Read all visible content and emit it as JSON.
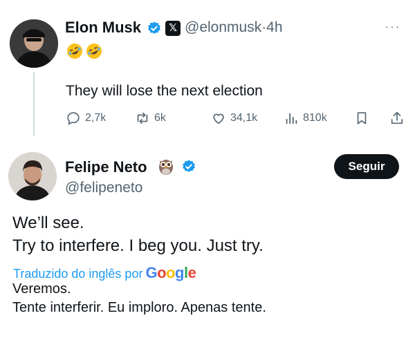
{
  "tweet1": {
    "author_name": "Elon Musk",
    "handle_time": "@elonmusk·4h",
    "more_icon": "more-horizontal-icon",
    "emojis": [
      "rofl-emoji",
      "rofl-emoji"
    ],
    "text": "They will lose the next election",
    "actions": {
      "reply_count": "2,7k",
      "retweet_count": "6k",
      "like_count": "34,1k",
      "view_count": "810k"
    }
  },
  "tweet2": {
    "author_name": "Felipe Neto",
    "handle": "@felipeneto",
    "follow_label": "Seguir",
    "lines": [
      "We’ll see.",
      "Try to interfere. I beg you. Just try."
    ],
    "translated_by": "Traduzido do inglês por",
    "google": [
      "G",
      "o",
      "o",
      "g",
      "l",
      "e"
    ],
    "translation_lines": [
      "Veremos.",
      "Tente interferir. Eu imploro. Apenas tente."
    ]
  },
  "colors": {
    "verified_blue": "#1d9bf0",
    "text_primary": "#0f1419",
    "text_secondary": "#536471",
    "link_blue": "#1d9bf0"
  }
}
